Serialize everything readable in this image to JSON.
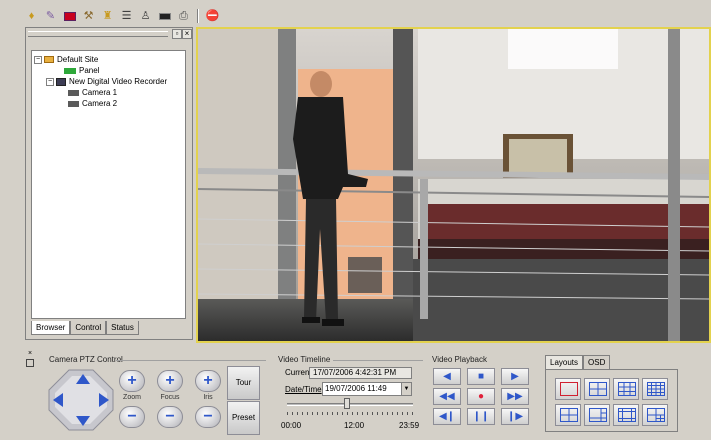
{
  "toolbar": {
    "buttons": [
      "torch-icon",
      "wand-icon",
      "map-icon",
      "tools-icon",
      "alarm-icon",
      "event-icon",
      "user-icon",
      "device-icon",
      "print-icon",
      "stop-icon"
    ]
  },
  "tree": {
    "site": "Default Site",
    "panel": "Panel",
    "recorder": "New Digital Video Recorder",
    "cameras": [
      "Camera 1",
      "Camera 2"
    ]
  },
  "left_tabs": {
    "browser": "Browser",
    "control": "Control",
    "status": "Status"
  },
  "ptz": {
    "title": "Camera PTZ Control",
    "zoom": "Zoom",
    "focus": "Focus",
    "iris": "Iris",
    "tour": "Tour",
    "preset": "Preset",
    "plus": "+",
    "minus": "−"
  },
  "timeline": {
    "title": "Video Timeline",
    "current_label": "Current",
    "current_value": "17/07/2006 4:42:31 PM",
    "datetime_label": "Date/Time",
    "datetime_value": "19/07/2006 11:49",
    "slider_fraction": 0.48,
    "tick_start": "00:00",
    "tick_mid": "12:00",
    "tick_end": "23:59"
  },
  "playback": {
    "title": "Video Playback"
  },
  "layouts": {
    "tab_layouts": "Layouts",
    "tab_osd": "OSD"
  },
  "colors": {
    "accent_blue": "#2f57c9",
    "record_red": "#e0203a",
    "video_border": "#e3d24e",
    "layout_selected": "#d02030"
  }
}
